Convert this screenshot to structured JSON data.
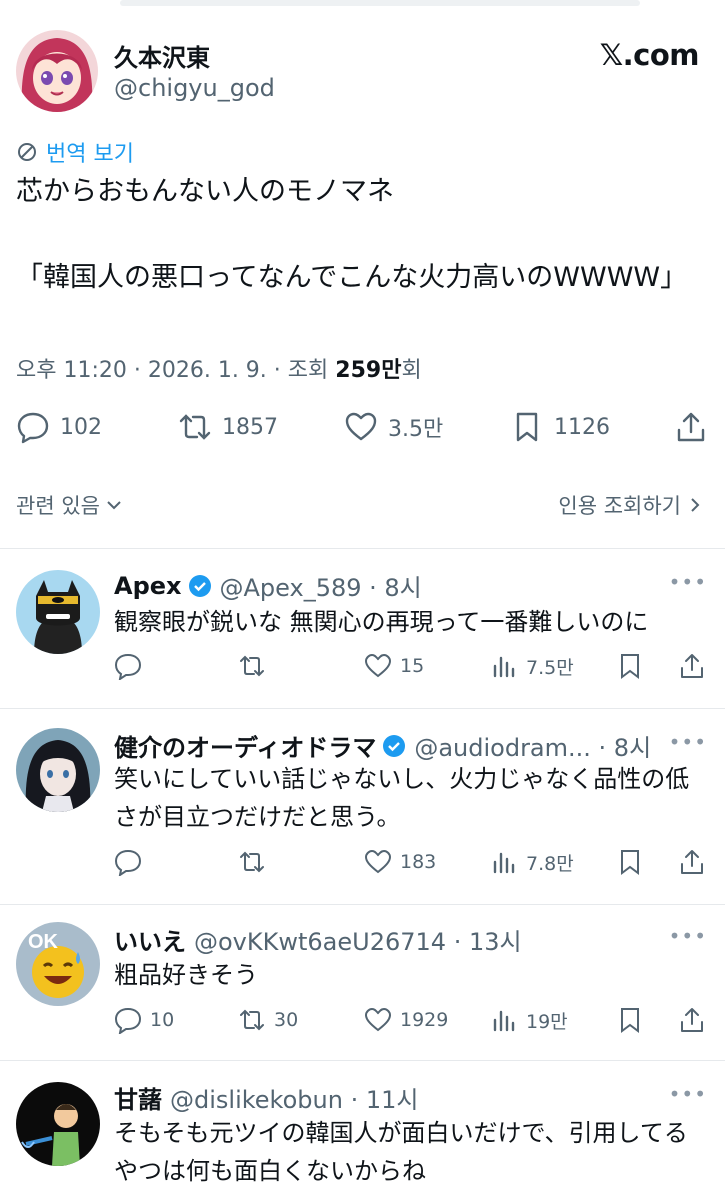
{
  "tweet": {
    "author_name": "久本沢東",
    "author_handle": "@chigyu_god",
    "site_label": "𝕏.com",
    "translate_label": "번역 보기",
    "body_line1": "芯からおもんない人のモノマネ",
    "body_line2": "「韓国人の悪口ってなんでこんな火力高いのWWWW」",
    "meta_prefix": "오후 11:20 · 2026. 1. 9. · 조회 ",
    "views_bold": "259만",
    "views_suffix": "회",
    "reply_count": "102",
    "retweet_count": "1857",
    "like_count": "3.5만",
    "bookmark_count": "1126"
  },
  "related_label": "관련 있음",
  "quote_views_label": "인용 조회하기",
  "replies": [
    {
      "name": "Apex",
      "verified": true,
      "handle": "@Apex_589 · 8시",
      "text": "観察眼が鋭いな 無関心の再現って一番難しいのに",
      "replies": "",
      "retweets": "",
      "likes": "15",
      "views": "7.5만"
    },
    {
      "name": "健介のオーディオドラマ",
      "verified": true,
      "handle": "@audiodram... · 8시",
      "text": "笑いにしていい話じゃないし、火力じゃなく品性の低さが目立つだけだと思う。",
      "replies": "",
      "retweets": "",
      "likes": "183",
      "views": "7.8만"
    },
    {
      "name": "いいえ",
      "verified": false,
      "handle": "@ovKKwt6aeU26714 · 13시",
      "text": "粗品好きそう",
      "replies": "10",
      "retweets": "30",
      "likes": "1929",
      "views": "19만"
    },
    {
      "name": "甘藷",
      "verified": false,
      "handle": "@dislikekobun · 11시",
      "text": "そもそも元ツイの韓国人が面白いだけで、引用してるやつは何も面白くないからね",
      "replies": "",
      "retweets": "",
      "likes": "",
      "views": ""
    }
  ],
  "colors": {
    "accent": "#1d9bf0",
    "text_primary": "#0f1419",
    "text_secondary": "#536471",
    "divider": "#e6e9ec"
  }
}
